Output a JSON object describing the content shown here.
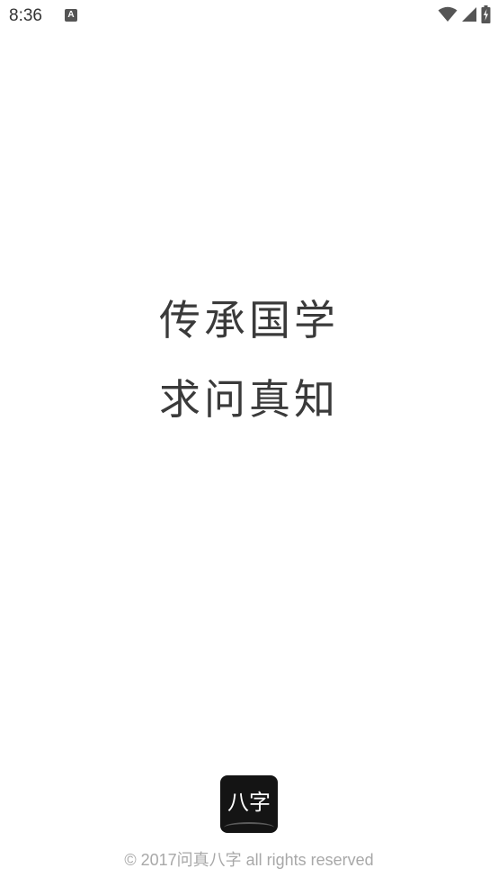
{
  "status_bar": {
    "time": "8:36",
    "notification_icon": "A",
    "icons": [
      "wifi-icon",
      "signal-icon",
      "battery-charging-icon"
    ]
  },
  "splash": {
    "slogan_line_1": "传承国学",
    "slogan_line_2": "求问真知"
  },
  "logo": {
    "text": "八字"
  },
  "footer": {
    "copyright": "©  2017问真八字 all rights reserved"
  },
  "colors": {
    "background": "#ffffff",
    "slogan_text": "#3a3a3a",
    "logo_bg": "#141414",
    "copyright_text": "#a8a8a8"
  }
}
